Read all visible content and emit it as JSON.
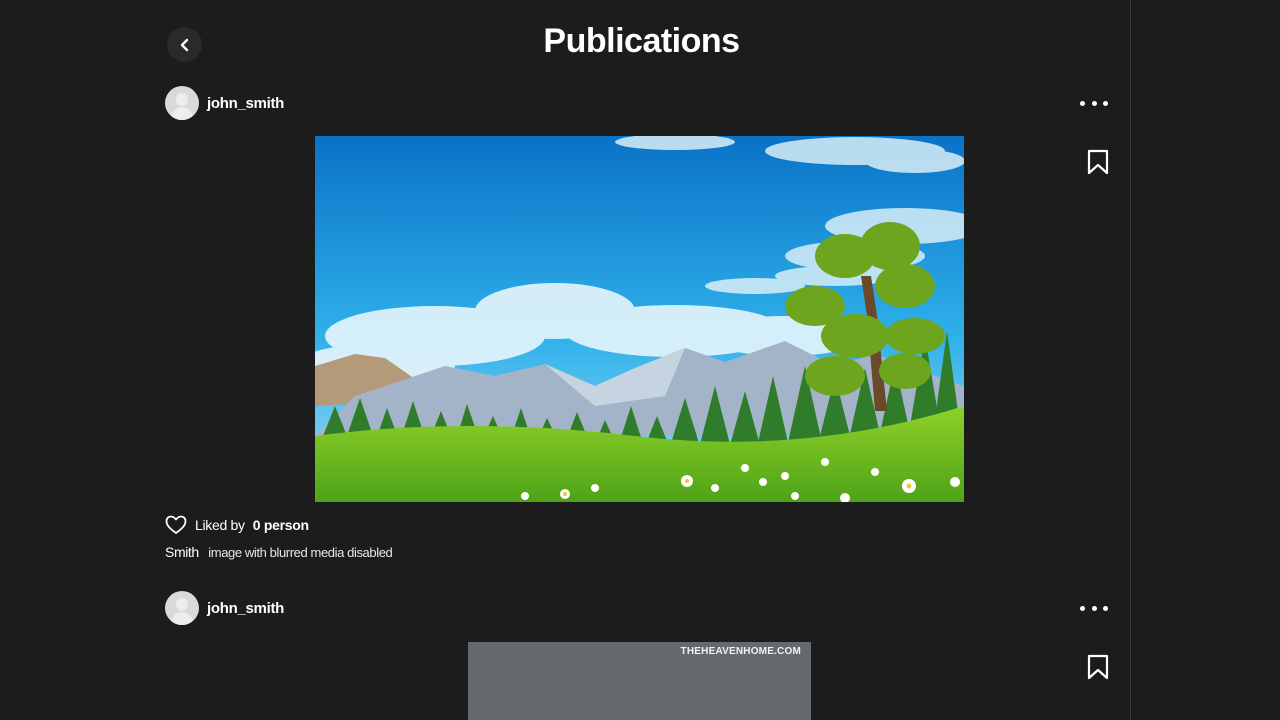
{
  "header": {
    "title": "Publications",
    "back_icon": "chevron-left-icon"
  },
  "posts": [
    {
      "username": "john_smith",
      "liked_prefix": "Liked by",
      "liked_count": "0 person",
      "caption_user": "Smith",
      "caption_text": "image with blurred media disabled",
      "media_description": "landscape-illustration"
    },
    {
      "username": "john_smith",
      "watermark": "THEHEAVENHOME.COM",
      "media_description": "gray-placeholder-image"
    }
  ],
  "colors": {
    "background": "#1c1c1c",
    "text": "#ffffff",
    "divider": "#3a3a3a"
  }
}
